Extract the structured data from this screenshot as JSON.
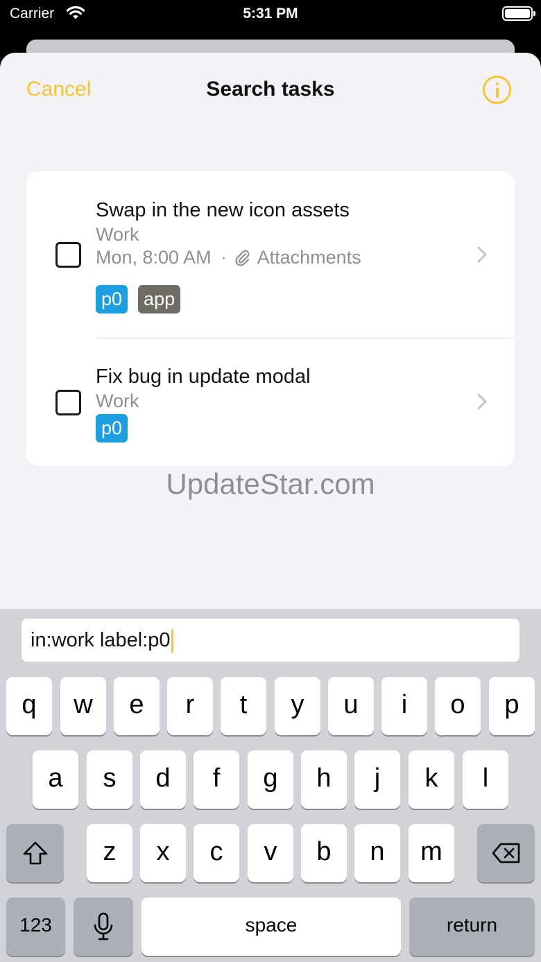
{
  "status_bar": {
    "carrier": "Carrier",
    "time": "5:31 PM"
  },
  "nav": {
    "cancel_label": "Cancel",
    "title": "Search tasks",
    "info_icon": "info-circle-icon"
  },
  "colors": {
    "accent": "#f7c531",
    "label_p0": "#1b9fe0",
    "label_app": "#6f6c66"
  },
  "tasks": [
    {
      "title": "Swap in the new icon assets",
      "project": "Work",
      "due": "Mon, 8:00 AM",
      "separator": "·",
      "attachments": "Attachments",
      "labels": [
        "p0",
        "app"
      ]
    },
    {
      "title": "Fix bug in update modal",
      "project": "Work",
      "labels": [
        "p0"
      ]
    }
  ],
  "watermark": "UpdateStar.com",
  "search": {
    "query": "in:work label:p0"
  },
  "keyboard": {
    "row1": [
      "q",
      "w",
      "e",
      "r",
      "t",
      "y",
      "u",
      "i",
      "o",
      "p"
    ],
    "row2": [
      "a",
      "s",
      "d",
      "f",
      "g",
      "h",
      "j",
      "k",
      "l"
    ],
    "row3": [
      "z",
      "x",
      "c",
      "v",
      "b",
      "n",
      "m"
    ],
    "numbers_label": "123",
    "space_label": "space",
    "return_label": "return"
  }
}
